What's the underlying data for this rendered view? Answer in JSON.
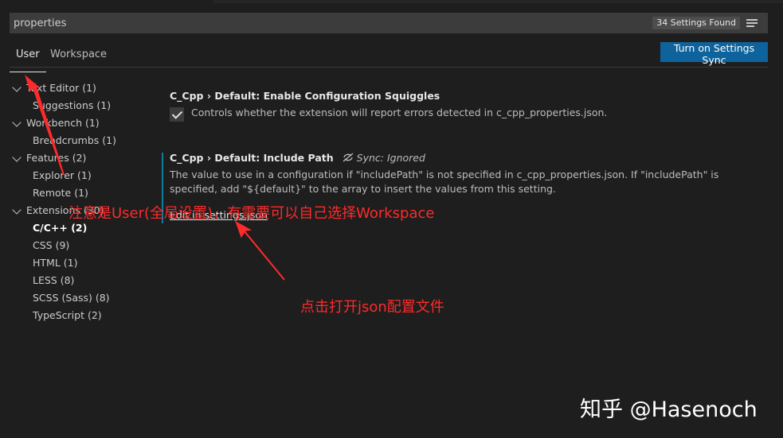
{
  "search": {
    "value": "properties",
    "result_count": "34 Settings Found"
  },
  "tabs": [
    {
      "label": "User"
    },
    {
      "label": "Workspace"
    }
  ],
  "sync_button": {
    "label": "Turn on Settings Sync"
  },
  "toc": [
    {
      "label": "Text Editor (1)",
      "level": 1
    },
    {
      "label": "Suggestions (1)",
      "level": 2
    },
    {
      "label": "Workbench (1)",
      "level": 1
    },
    {
      "label": "Breadcrumbs (1)",
      "level": 2
    },
    {
      "label": "Features (2)",
      "level": 1
    },
    {
      "label": "Explorer (1)",
      "level": 2
    },
    {
      "label": "Remote (1)",
      "level": 2
    },
    {
      "label": "Extensions (30)",
      "level": 1
    },
    {
      "label": "C/C++ (2)",
      "level": 2,
      "active": true
    },
    {
      "label": "CSS (9)",
      "level": 2
    },
    {
      "label": "HTML (1)",
      "level": 2
    },
    {
      "label": "LESS (8)",
      "level": 2
    },
    {
      "label": "SCSS (Sass) (8)",
      "level": 2
    },
    {
      "label": "TypeScript (2)",
      "level": 2
    }
  ],
  "settings": [
    {
      "category": "C_Cpp › Default: ",
      "name": "Enable Configuration Squiggles",
      "description": "Controls whether the extension will report errors detected in c_cpp_properties.json.",
      "checked": true
    },
    {
      "category": "C_Cpp › Default: ",
      "name": "Include Path",
      "sync_note": "Sync: Ignored",
      "description": "The value to use in a configuration if \"includePath\" is not specified in c_cpp_properties.json. If \"includePath\" is specified, add \"${default}\" to the array to insert the values from this setting.",
      "link": "Edit in settings.json"
    }
  ],
  "annotations": {
    "note_user": "注意是User(全局设置)，有需要可以自己选择Workspace",
    "note_json": "点击打开json配置文件"
  },
  "watermark": "知乎 @Hasenoch",
  "colors": {
    "accent": "#0e639c",
    "annotation": "#ff2a2a",
    "modified_bar": "#0c7d9d"
  }
}
